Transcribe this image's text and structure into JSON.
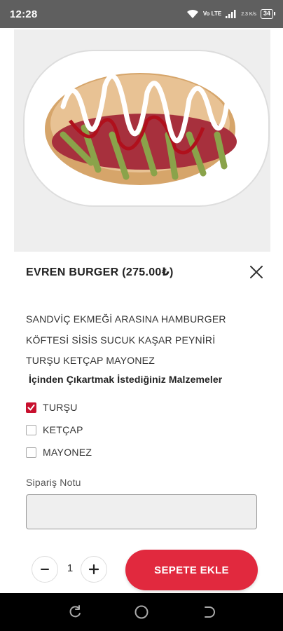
{
  "status_bar": {
    "time": "12:28",
    "network_label": "Vo LTE",
    "speed_label": "2.3 K/s",
    "battery": "34"
  },
  "product": {
    "title": "EVREN BURGER (275.00₺)",
    "image_icon": "sandwich-photo",
    "description_lines": [
      "SANDVİÇ EKMEĞİ ARASINA HAMBURGER",
      "KÖFTESİ SİSİS SUCUK KAŞAR PEYNİRİ",
      "TURŞU KETÇAP MAYONEZ"
    ]
  },
  "options": {
    "heading": "İçinden Çıkartmak İstediğiniz Malzemeler",
    "items": [
      {
        "label": "TURŞU",
        "checked": true
      },
      {
        "label": "KETÇAP",
        "checked": false
      },
      {
        "label": "MAYONEZ",
        "checked": false
      }
    ]
  },
  "note": {
    "label": "Sipariş Notu",
    "value": ""
  },
  "quantity": {
    "value": "1",
    "minus_symbol": "−",
    "plus_symbol": "+"
  },
  "cart": {
    "button_label": "SEPETE EKLE"
  },
  "colors": {
    "accent": "#e1293e",
    "checkbox_checked": "#c8102e",
    "status_bar": "#5f5f5f",
    "nav_bar": "#000000"
  },
  "icons": {
    "close": "close-icon",
    "checkmark": "checkmark-icon",
    "nav_recent": "recent-apps-icon",
    "nav_home": "home-icon",
    "nav_back": "back-icon"
  }
}
